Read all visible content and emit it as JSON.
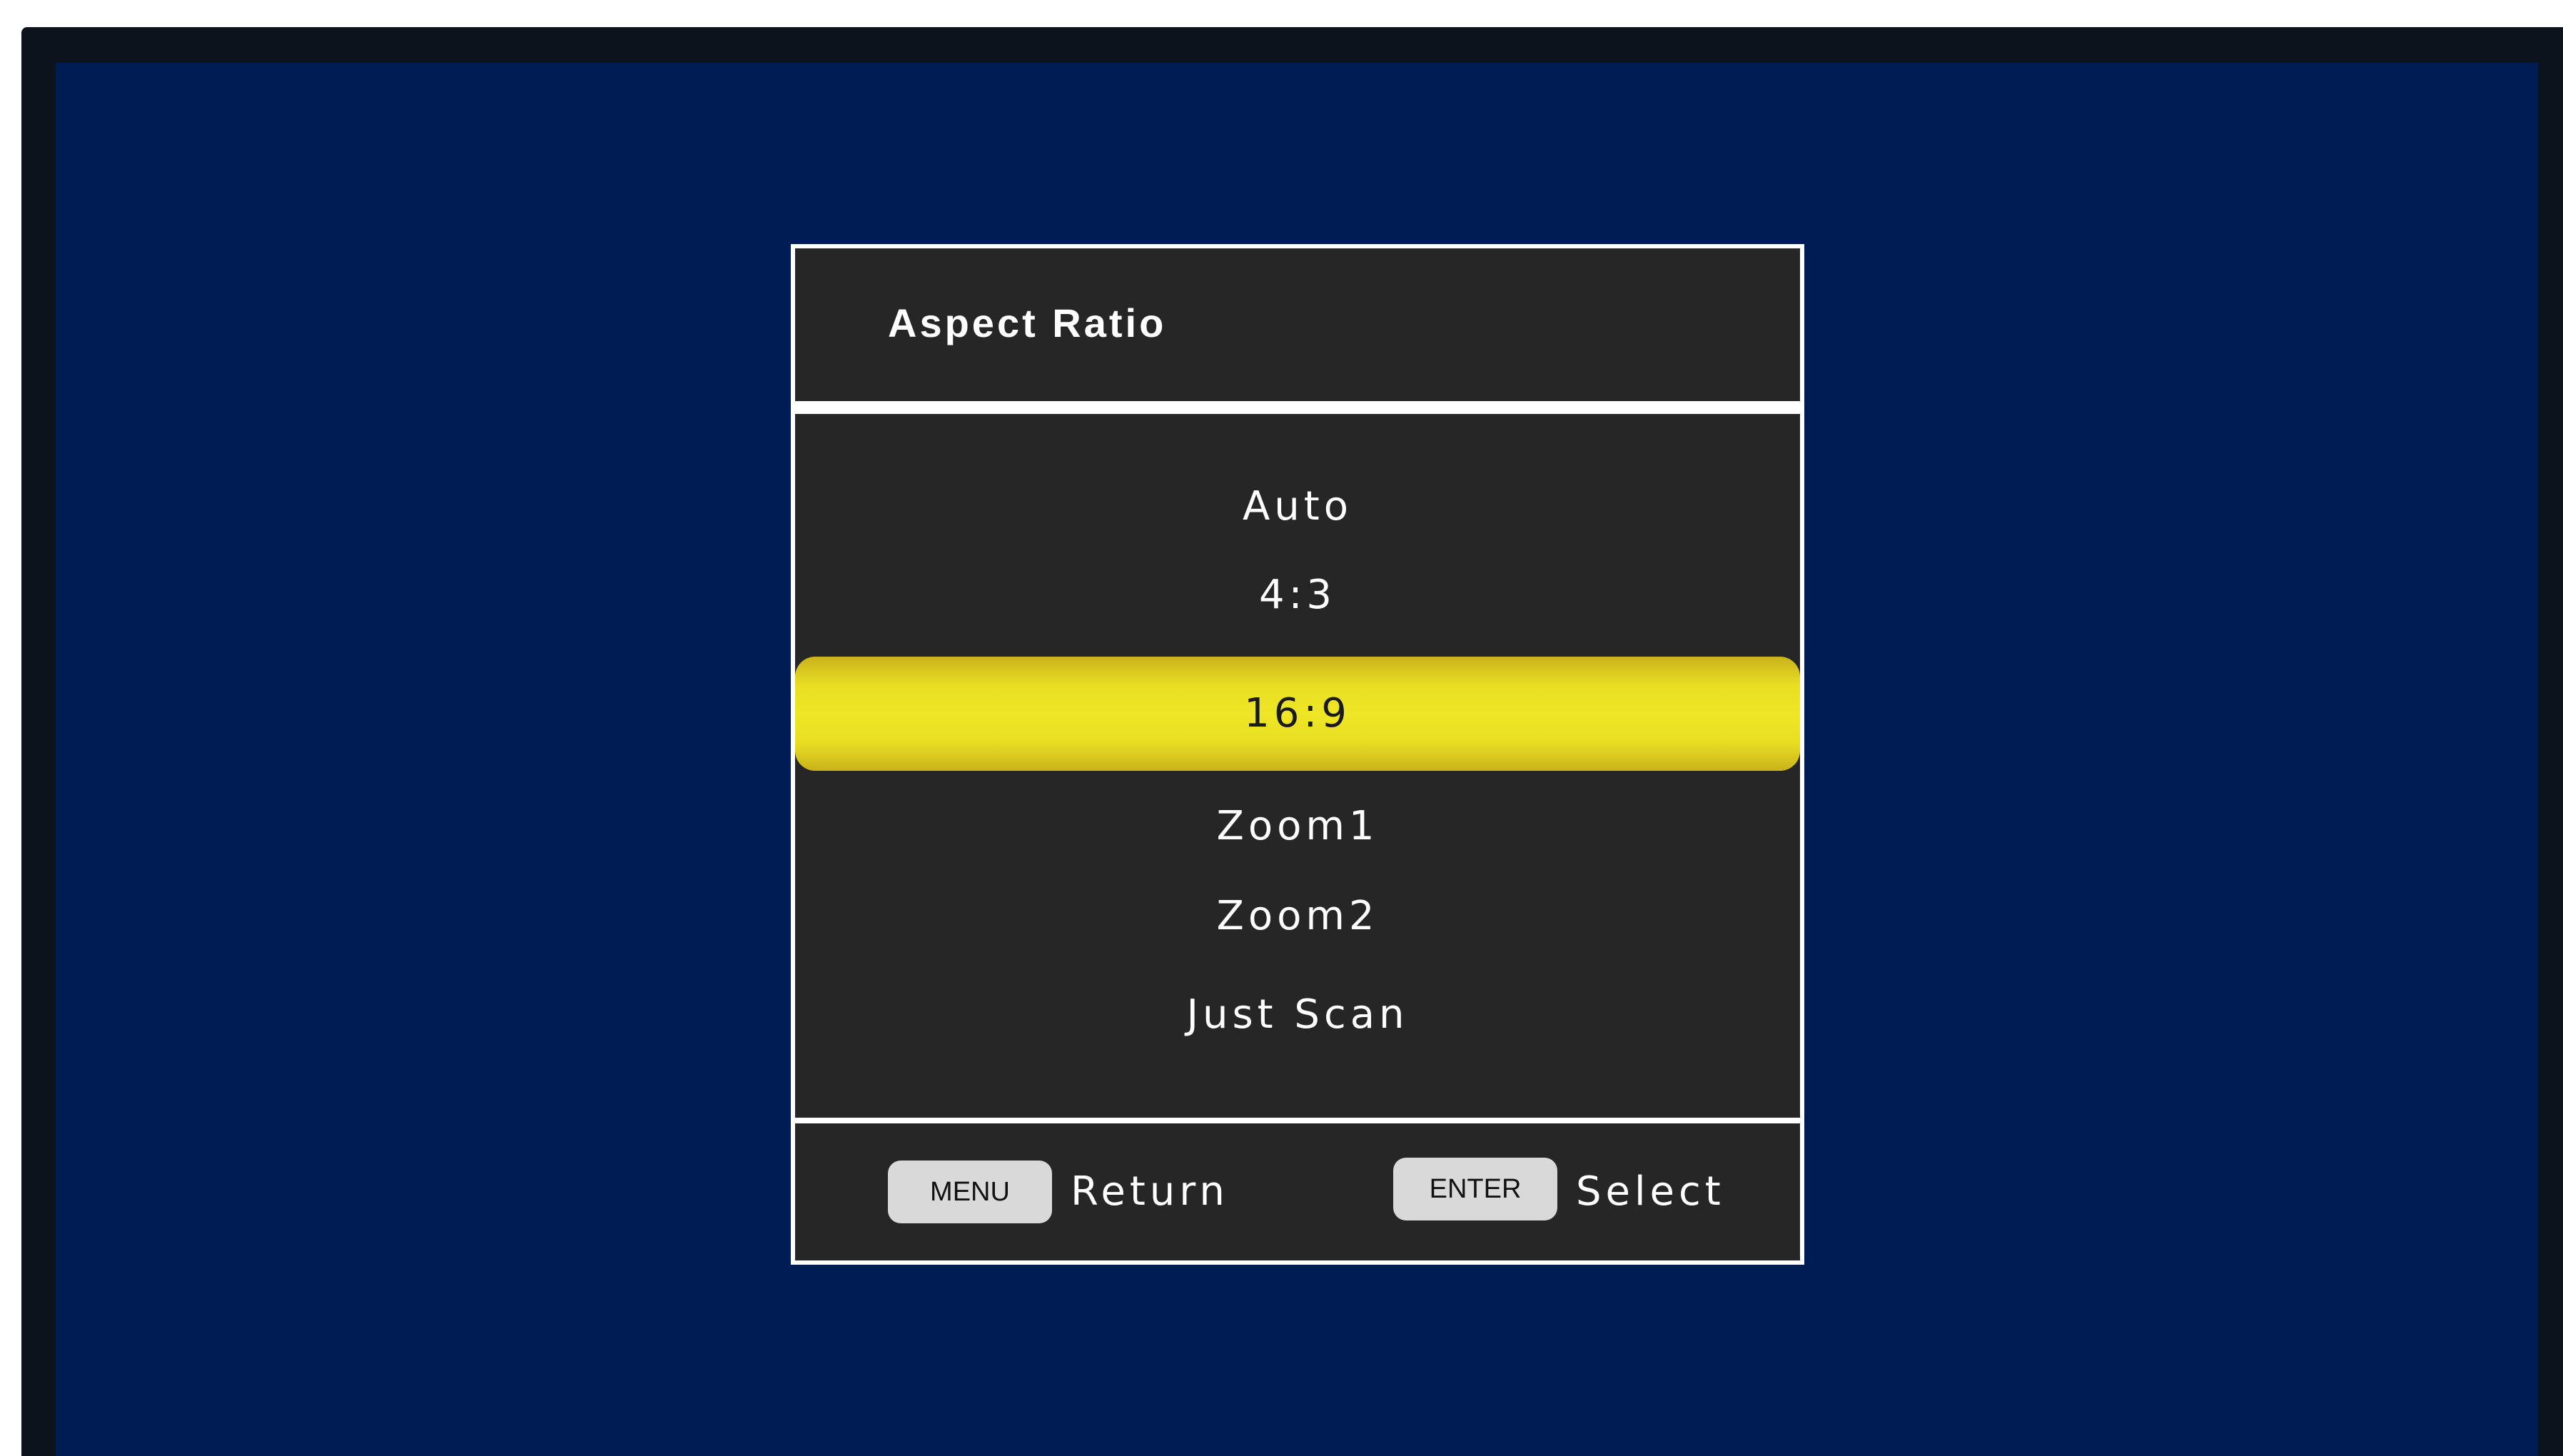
{
  "osd": {
    "title": "Aspect Ratio",
    "options": [
      {
        "label": "Auto",
        "selected": false
      },
      {
        "label": "4:3",
        "selected": false
      },
      {
        "label": "16:9",
        "selected": true
      },
      {
        "label": "Zoom1",
        "selected": false
      },
      {
        "label": "Zoom2",
        "selected": false
      },
      {
        "label": "Just Scan",
        "selected": false
      }
    ]
  },
  "footer": {
    "menu_key": "MENU",
    "menu_action": "Return",
    "enter_key": "ENTER",
    "enter_action": "Select"
  },
  "colors": {
    "screen_background": "#001c54",
    "panel_background": "#262626",
    "highlight": "#efe626",
    "border": "#ffffff"
  }
}
